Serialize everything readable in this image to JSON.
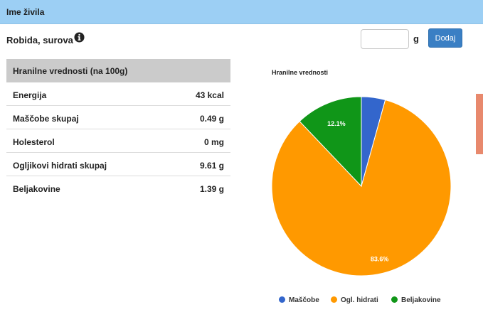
{
  "header": {
    "title": "Ime živila"
  },
  "food": {
    "name": "Robida, surova",
    "info_icon": "info-circle-icon"
  },
  "add_form": {
    "quantity_value": "",
    "unit": "g",
    "add_label": "Dodaj"
  },
  "table": {
    "header": "Hranilne vrednosti (na 100g)",
    "rows": [
      {
        "label": "Energija",
        "value": "43 kcal"
      },
      {
        "label": "Maščobe skupaj",
        "value": "0.49 g"
      },
      {
        "label": "Holesterol",
        "value": "0 mg"
      },
      {
        "label": "Ogljikovi hidrati skupaj",
        "value": "9.61 g"
      },
      {
        "label": "Beljakovine",
        "value": "1.39 g"
      }
    ]
  },
  "colors": {
    "header_bg": "#9ccff4",
    "button": "#3a7fc4",
    "fat": "#3366cc",
    "carbs": "#ff9900",
    "protein": "#109618"
  },
  "chart_data": {
    "type": "pie",
    "title": "Hranilne vrednosti",
    "legend_position": "bottom",
    "slices": [
      {
        "name": "Maščobe",
        "value": 4.3,
        "color": "#3366cc",
        "label": ""
      },
      {
        "name": "Ogl. hidrati",
        "value": 83.6,
        "color": "#ff9900",
        "label": "83.6%"
      },
      {
        "name": "Beljakovine",
        "value": 12.1,
        "color": "#109618",
        "label": "12.1%"
      }
    ]
  }
}
